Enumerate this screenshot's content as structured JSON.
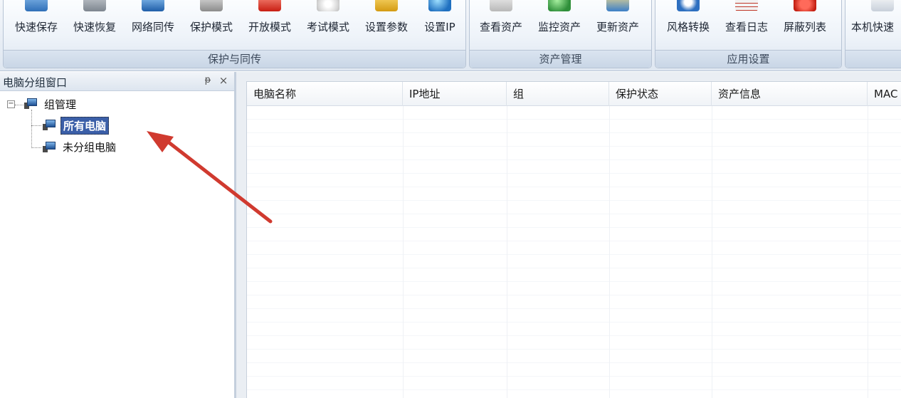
{
  "ribbon": {
    "groups": [
      {
        "label": "保护与同传",
        "buttons": [
          {
            "label": "快速保存",
            "icon": "quick-save-icon"
          },
          {
            "label": "快速恢复",
            "icon": "quick-restore-icon"
          },
          {
            "label": "网络同传",
            "icon": "network-sync-icon"
          },
          {
            "label": "保护模式",
            "icon": "protect-mode-icon"
          },
          {
            "label": "开放模式",
            "icon": "open-mode-icon"
          },
          {
            "label": "考试模式",
            "icon": "exam-mode-icon"
          },
          {
            "label": "设置参数",
            "icon": "settings-icon"
          },
          {
            "label": "设置IP",
            "icon": "set-ip-icon"
          }
        ]
      },
      {
        "label": "资产管理",
        "buttons": [
          {
            "label": "查看资产",
            "icon": "view-assets-icon"
          },
          {
            "label": "监控资产",
            "icon": "monitor-assets-icon"
          },
          {
            "label": "更新资产",
            "icon": "update-assets-icon"
          }
        ]
      },
      {
        "label": "应用设置",
        "buttons": [
          {
            "label": "风格转换",
            "icon": "style-switch-icon"
          },
          {
            "label": "查看日志",
            "icon": "view-log-icon"
          },
          {
            "label": "屏蔽列表",
            "icon": "block-list-icon"
          }
        ]
      },
      {
        "label": "",
        "buttons": [
          {
            "label": "本机快速",
            "icon": "local-quick-icon"
          }
        ]
      }
    ]
  },
  "left_panel": {
    "title": "电脑分组窗口",
    "pin_glyph": "ᵽ",
    "close_glyph": "×",
    "tree": {
      "root": {
        "label": "组管理",
        "expander": "−"
      },
      "children": [
        {
          "label": "所有电脑",
          "selected": true
        },
        {
          "label": "未分组电脑",
          "selected": false
        }
      ]
    }
  },
  "grid": {
    "columns": [
      "电脑名称",
      "IP地址",
      "组",
      "保护状态",
      "资产信息",
      "MAC"
    ]
  },
  "colors": {
    "selection": "#3b5fa8",
    "annotation_arrow": "#d03a2f"
  }
}
